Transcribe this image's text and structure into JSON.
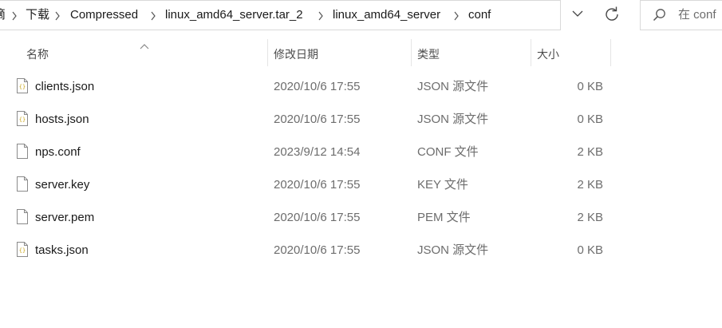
{
  "breadcrumb": {
    "items": [
      {
        "label": "滴"
      },
      {
        "label": "下载"
      },
      {
        "label": "Compressed"
      },
      {
        "label": "linux_amd64_server.tar_2"
      },
      {
        "label": "linux_amd64_server"
      },
      {
        "label": "conf"
      }
    ]
  },
  "search": {
    "placeholder": "在 conf"
  },
  "columns": {
    "name": "名称",
    "date": "修改日期",
    "type": "类型",
    "size": "大小"
  },
  "files": [
    {
      "name": "clients.json",
      "date": "2020/10/6 17:55",
      "type": "JSON 源文件",
      "size": "0 KB",
      "icon": "json-file-icon"
    },
    {
      "name": "hosts.json",
      "date": "2020/10/6 17:55",
      "type": "JSON 源文件",
      "size": "0 KB",
      "icon": "json-file-icon"
    },
    {
      "name": "nps.conf",
      "date": "2023/9/12 14:54",
      "type": "CONF 文件",
      "size": "2 KB",
      "icon": "file-icon"
    },
    {
      "name": "server.key",
      "date": "2020/10/6 17:55",
      "type": "KEY 文件",
      "size": "2 KB",
      "icon": "file-icon"
    },
    {
      "name": "server.pem",
      "date": "2020/10/6 17:55",
      "type": "PEM 文件",
      "size": "2 KB",
      "icon": "file-icon"
    },
    {
      "name": "tasks.json",
      "date": "2020/10/6 17:55",
      "type": "JSON 源文件",
      "size": "0 KB",
      "icon": "json-file-icon"
    }
  ]
}
